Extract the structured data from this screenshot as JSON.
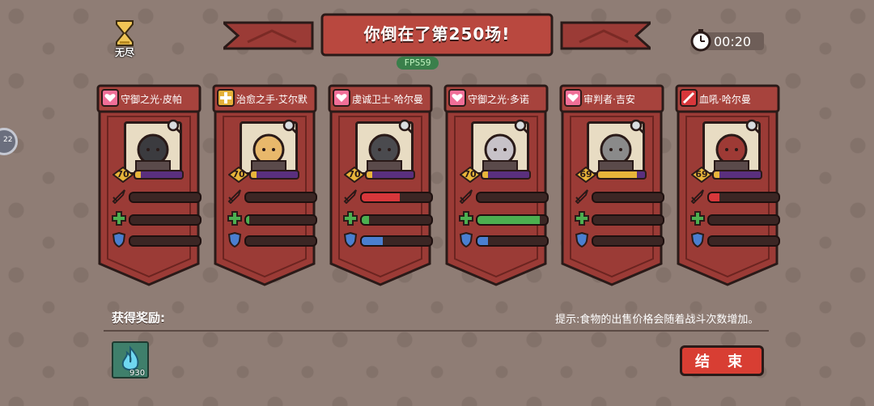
{
  "mode": {
    "label": "无尽",
    "icon": "hourglass-icon"
  },
  "banner": {
    "title": "你倒在了第250场!"
  },
  "fps": "FPS59",
  "timer": "00:20",
  "side_badge": "22",
  "cards": [
    {
      "name": "守御之光·皮帕",
      "role_icon": "heart-shield-icon",
      "level": "70",
      "xp": 0.12,
      "attack": 0.0,
      "heal": 0.0,
      "defense": 0.0
    },
    {
      "name": "治愈之手·艾尔默",
      "role_icon": "plus-icon",
      "level": "70",
      "xp": 0.12,
      "attack": 0.0,
      "heal": 0.05,
      "defense": 0.0
    },
    {
      "name": "虔诚卫士·哈尔曼",
      "role_icon": "heart-shield-icon",
      "level": "70",
      "xp": 0.12,
      "attack": 0.55,
      "heal": 0.1,
      "defense": 0.3
    },
    {
      "name": "守御之光·多诺",
      "role_icon": "heart-shield-icon",
      "level": "70",
      "xp": 0.12,
      "attack": 0.0,
      "heal": 0.9,
      "defense": 0.15
    },
    {
      "name": "审判者·吉安",
      "role_icon": "heart-shield-icon",
      "level": "69",
      "xp": 0.82,
      "attack": 0.0,
      "heal": 0.0,
      "defense": 0.0
    },
    {
      "name": "血吼·哈尔曼",
      "role_icon": "sword-icon",
      "level": "69",
      "xp": 0.12,
      "attack": 0.15,
      "heal": 0.0,
      "defense": 0.0
    }
  ],
  "colors": {
    "attack": "#d8373b",
    "heal": "#4caf50",
    "defense": "#4a7fd0"
  },
  "rewards": {
    "label": "获得奖励:",
    "item_icon": "blue-flame-icon",
    "item_count": "930"
  },
  "hint": "提示:食物的出售价格会随着战斗次数增加。",
  "end_button": "结 束"
}
